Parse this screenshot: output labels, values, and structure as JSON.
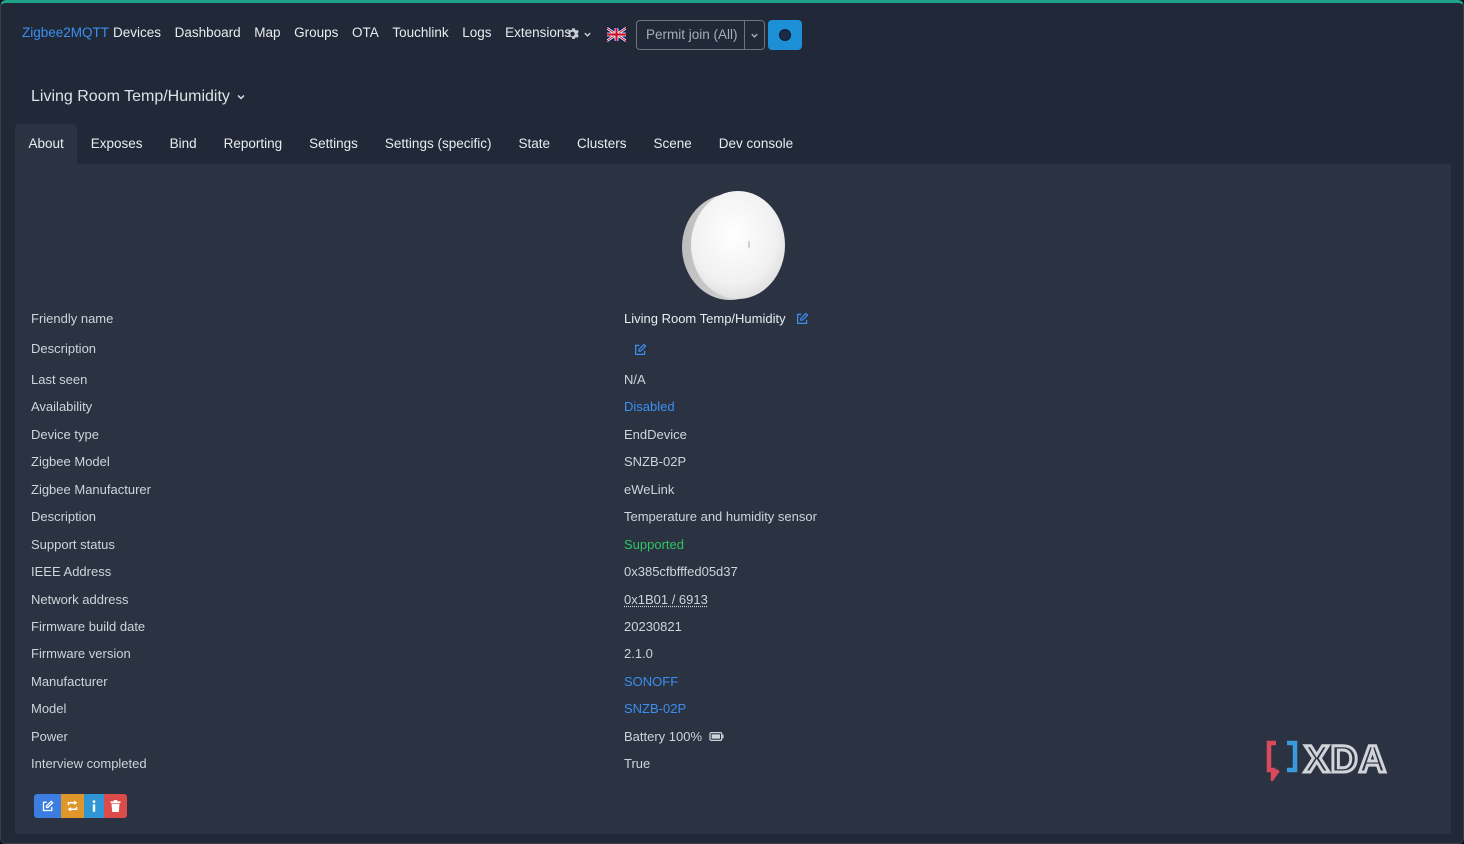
{
  "navbar": {
    "brand": "Zigbee2MQTT",
    "links": [
      "Devices",
      "Dashboard",
      "Map",
      "Groups",
      "OTA",
      "Touchlink",
      "Logs",
      "Extensions"
    ],
    "settings_icon": "gear-icon",
    "language_icon": "uk-flag-icon",
    "permit_join_label": "Permit join (All)",
    "permit_caret_icon": "chevron-down-icon",
    "theme_toggle_icon": "circle-icon"
  },
  "device": {
    "title": "Living Room Temp/Humidity"
  },
  "tabs": [
    "About",
    "Exposes",
    "Bind",
    "Reporting",
    "Settings",
    "Settings (specific)",
    "State",
    "Clusters",
    "Scene",
    "Dev console"
  ],
  "active_tab": "About",
  "about": {
    "rows": [
      {
        "label": "Friendly name",
        "value": "Living Room Temp/Humidity"
      },
      {
        "label": "Description",
        "value": ""
      },
      {
        "label": "Last seen",
        "value": "N/A"
      },
      {
        "label": "Availability",
        "value": "Disabled"
      },
      {
        "label": "Device type",
        "value": "EndDevice"
      },
      {
        "label": "Zigbee Model",
        "value": "SNZB-02P"
      },
      {
        "label": "Zigbee Manufacturer",
        "value": "eWeLink"
      },
      {
        "label": "Description",
        "value": "Temperature and humidity sensor"
      },
      {
        "label": "Support status",
        "value": "Supported"
      },
      {
        "label": "IEEE Address",
        "value": "0x385cfbfffed05d37"
      },
      {
        "label": "Network address",
        "value": "0x1B01 / 6913"
      },
      {
        "label": "Firmware build date",
        "value": "20230821"
      },
      {
        "label": "Firmware version",
        "value": "2.1.0"
      },
      {
        "label": "Manufacturer",
        "value": "SONOFF"
      },
      {
        "label": "Model",
        "value": "SNZB-02P"
      },
      {
        "label": "Power",
        "value": "Battery 100%"
      },
      {
        "label": "Interview completed",
        "value": "True"
      }
    ]
  },
  "actions": {
    "edit_icon": "edit-icon",
    "reconfigure_icon": "swap-icon",
    "interview_icon": "info-icon",
    "remove_icon": "trash-icon"
  },
  "watermark": "XDA",
  "colors": {
    "accent": "#3b8ff0",
    "success": "#2fc463",
    "background": "#212837",
    "panel": "#2b3242"
  }
}
